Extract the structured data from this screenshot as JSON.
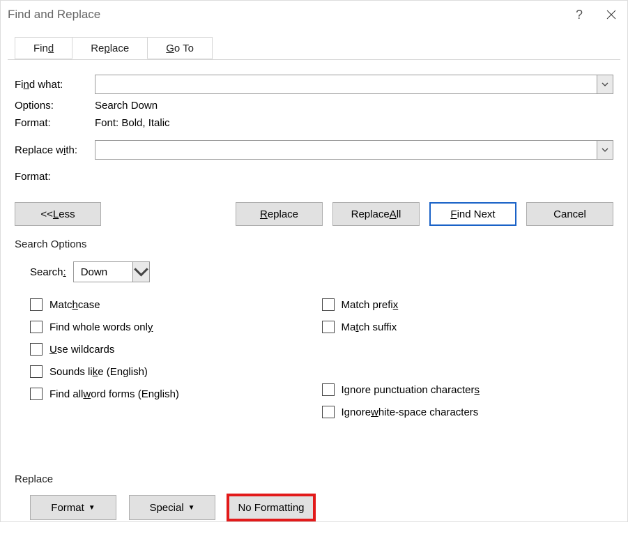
{
  "title": "Find and Replace",
  "system": {
    "help": "?",
    "close": "×"
  },
  "tabs": {
    "find": "Find",
    "find_u": "d",
    "replace": "Replace",
    "replace_u": "p",
    "goto": "Go To",
    "goto_u": "G"
  },
  "find": {
    "label_pre": "Fi",
    "label_u": "n",
    "label_post": "d what:",
    "value": "",
    "options_label": "Options:",
    "options_value": "Search Down",
    "format_label": "Format:",
    "format_value": "Font: Bold, Italic"
  },
  "replace": {
    "label_pre": "Replace w",
    "label_u": "i",
    "label_post": "th:",
    "value": "",
    "format_label": "Format:",
    "format_value": ""
  },
  "buttons": {
    "less_pre": "<< ",
    "less_u": "L",
    "less_post": "ess",
    "replace_u": "R",
    "replace_post": "eplace",
    "replaceall_pre": "Replace ",
    "replaceall_u": "A",
    "replaceall_post": "ll",
    "findnext_u": "F",
    "findnext_post": "ind Next",
    "cancel": "Cancel"
  },
  "search_options": {
    "title": "Search Options",
    "direction_label_pre": "Search",
    "direction_label_u": ":",
    "direction_value": "Down",
    "left": [
      {
        "pre": "Matc",
        "u": "h",
        "post": " case"
      },
      {
        "pre": "Find whole words onl",
        "u": "y",
        "post": ""
      },
      {
        "pre": "",
        "u": "U",
        "post": "se wildcards"
      },
      {
        "pre": "Sounds li",
        "u": "k",
        "post": "e (English)"
      },
      {
        "pre": "Find all ",
        "u": "w",
        "post": "ord forms (English)"
      }
    ],
    "right_top": [
      {
        "pre": "Match prefi",
        "u": "x",
        "post": ""
      },
      {
        "pre": "Ma",
        "u": "t",
        "post": "ch suffix"
      }
    ],
    "right_bottom": [
      {
        "pre": "Ignore punctuation character",
        "u": "s",
        "post": ""
      },
      {
        "pre": "Ignore ",
        "u": "w",
        "post": "hite-space characters"
      }
    ]
  },
  "bottom": {
    "title": "Replace",
    "format_pre": "F",
    "format_u": "o",
    "format_post": "rmat",
    "special_pre": "Sp",
    "special_u": "e",
    "special_post": "cial",
    "noformat_pre": "No Forma",
    "noformat_u": "t",
    "noformat_post": "ting"
  }
}
